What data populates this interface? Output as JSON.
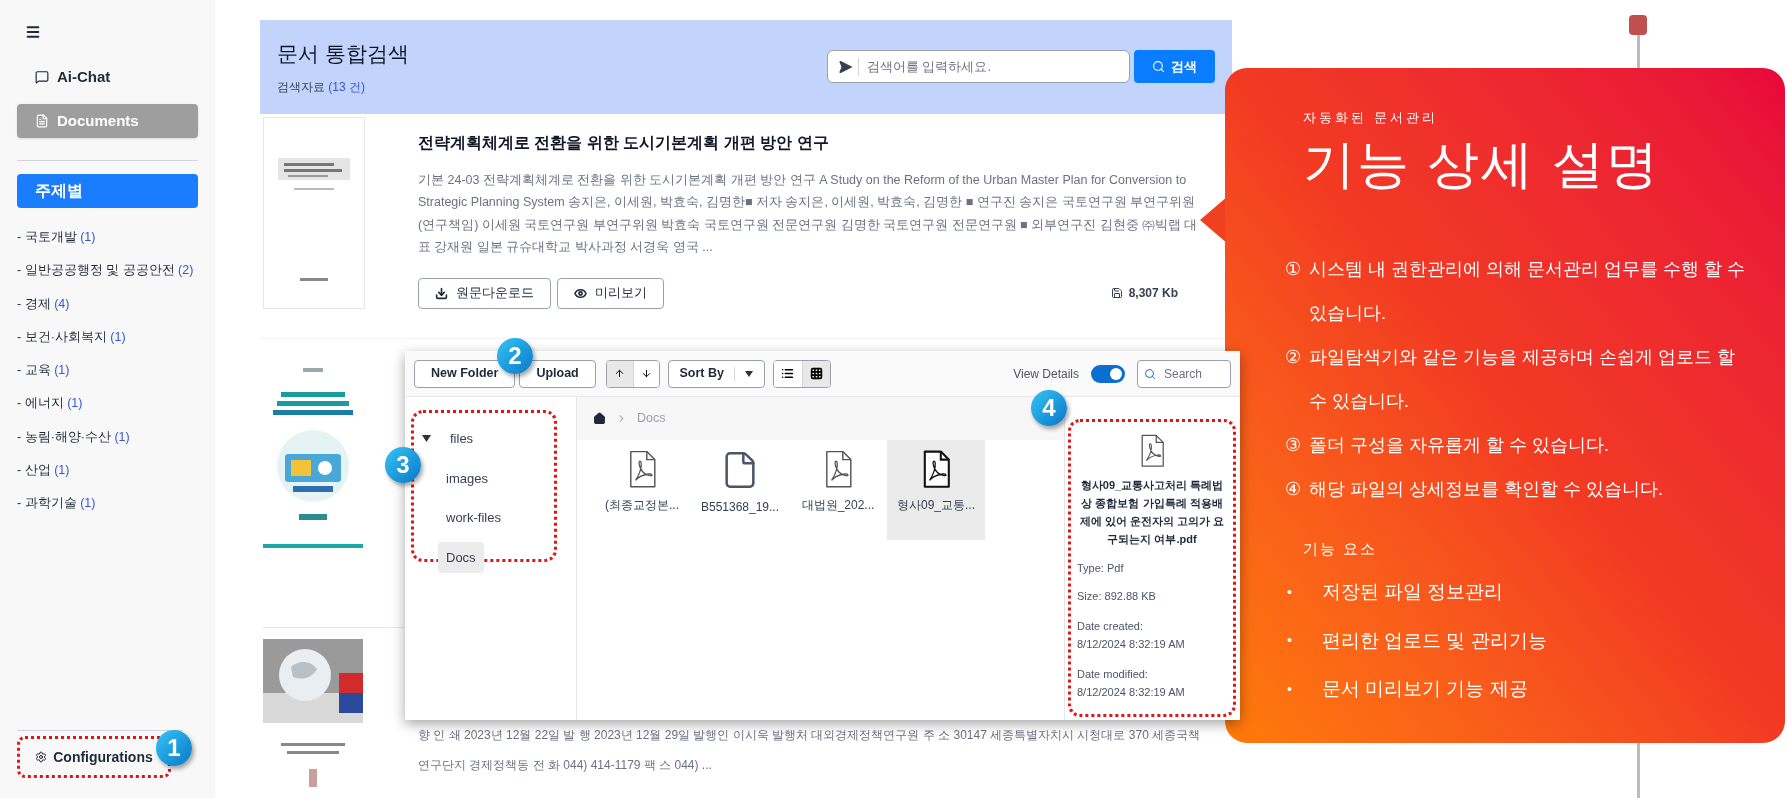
{
  "sidebar": {
    "nav": [
      {
        "label": "Ai-Chat",
        "selected": false
      },
      {
        "label": "Documents",
        "selected": true
      }
    ],
    "topic_button": "주제별",
    "categories": [
      {
        "name": "- 국토개발",
        "count": "(1)"
      },
      {
        "name": "- 일반공공행정 및 공공안전",
        "count": "(2)"
      },
      {
        "name": "- 경제",
        "count": "(4)"
      },
      {
        "name": "- 보건·사회복지",
        "count": "(1)"
      },
      {
        "name": "- 교육",
        "count": "(1)"
      },
      {
        "name": "- 에너지",
        "count": "(1)"
      },
      {
        "name": "- 농림·해양·수산",
        "count": "(1)"
      },
      {
        "name": "- 산업",
        "count": "(1)"
      },
      {
        "name": "- 과학기술",
        "count": "(1)"
      }
    ],
    "config_label": "Configurations"
  },
  "header": {
    "title": "문서 통합검색",
    "result_label": "검색자료",
    "result_count": "(13 건)",
    "search_placeholder": "검색어를 입력하세요.",
    "search_button": "검색"
  },
  "results": [
    {
      "kind": "full",
      "title": "전략계획체계로 전환을 위한 도시기본계획 개편 방안 연구",
      "description": "기본 24-03 전략계획체계로 전환을 위한 도시기본계획 개편 방안 연구 A Study on the Reform of the Urban Master Plan for Conversion to Strategic Planning System 송지은, 이세원, 박효숙, 김명한■ 저자 송지은, 이세원, 박효숙, 김명한 ■ 연구진 송지은 국토연구원 부연구위원(연구책임) 이세원 국토연구원 부연구위원 박효숙 국토연구원 전문연구원 김명한 국토연구원 전문연구원 ■ 외부연구진 김현중 ㈜빅랩 대표 강재원 일본 규슈대학교 박사과정 서경욱 영국 ...",
      "actions": [
        {
          "label": "원문다운로드"
        },
        {
          "label": "미리보기"
        }
      ],
      "size": "8,307 Kb"
    },
    {
      "kind": "cover_only"
    },
    {
      "kind": "text_only",
      "description": "향 인 쇄 2023년 12월 22일 발 행 2023년 12월 29일 발행인 이시욱 발행처 대외경제정책연구원 주 소 30147 세종특별자치시 시청대로 370 세종국책연구단지 경제정책동 전 화 044) 414-1179 팩 스 044) ..."
    }
  ],
  "explorer": {
    "toolbar": {
      "buttons": [
        "New Folder",
        "Upload"
      ],
      "sort_order": [
        {
          "selected": true
        },
        {
          "selected": false
        }
      ],
      "sort_by": "Sort By",
      "views": [
        {
          "kind": "list",
          "selected": false
        },
        {
          "kind": "grid",
          "selected": true
        }
      ],
      "view_details_label": "View Details",
      "view_details_on": true,
      "search_placeholder": "Search"
    },
    "tree": [
      {
        "name": "files",
        "expanded": true,
        "selected": false,
        "children": [
          {
            "name": "images",
            "selected": false
          },
          {
            "name": "work-files",
            "selected": false
          },
          {
            "name": "Docs",
            "selected": true
          }
        ]
      }
    ],
    "breadcrumb": [
      "Docs"
    ],
    "files": [
      {
        "name": "(최종교정본...",
        "kind": "pdf",
        "selected": false
      },
      {
        "name": "B551368_19...",
        "kind": "file",
        "selected": false
      },
      {
        "name": "대법원_202...",
        "kind": "pdf",
        "selected": false
      },
      {
        "name": "형사09_교통...",
        "kind": "pdf",
        "selected": true
      }
    ],
    "details": {
      "name": "형사09_교통사고처리 특례법상 종합보험 가입특례 적용배제에 있어 운전자의 고의가 요구되는지 여부.pdf",
      "fields": [
        {
          "kind": "inline",
          "label": "Type:",
          "value": "Pdf"
        },
        {
          "kind": "inline",
          "label": "Size:",
          "value": "892.88 KB"
        },
        {
          "kind": "stacked",
          "label": "Date created:",
          "value": "8/12/2024 8:32:19 AM"
        },
        {
          "kind": "stacked",
          "label": "Date modified:",
          "value": "8/12/2024 8:32:19 AM"
        }
      ]
    }
  },
  "callout": {
    "eyebrow": "자동화된 문서관리",
    "title": "기능 상세 설명",
    "steps": [
      {
        "marker": "①",
        "text": "시스템 내 권한관리에 의해 문서관리 업무를 수행 할 수 있습니다."
      },
      {
        "marker": "②",
        "text": "파일탐색기와 같은 기능을 제공하며 손쉽게 업로드 할 수 있습니다."
      },
      {
        "marker": "③",
        "text": "폴더 구성을 자유롭게 할 수 있습니다."
      },
      {
        "marker": "④",
        "text": "해당 파일의 상세정보를 확인할 수 있습니다."
      }
    ],
    "features_title": "기능 요소",
    "features": [
      {
        "bullet": "•",
        "text": "저장된 파일 정보관리"
      },
      {
        "bullet": "•",
        "text": "편리한 업로드 및 관리기능"
      },
      {
        "bullet": "•",
        "text": "문서 미리보기 기능 제공"
      }
    ]
  },
  "annotations": [
    {
      "number": "1"
    },
    {
      "number": "2"
    },
    {
      "number": "3"
    },
    {
      "number": "4"
    }
  ]
}
